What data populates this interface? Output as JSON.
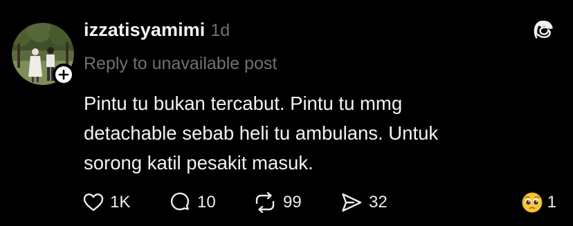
{
  "post": {
    "username": "izzatisyamimi",
    "timestamp": "1d",
    "reply_note": "Reply to unavailable post",
    "body_lines": [
      "Pintu tu bukan tercabut. Pintu tu mmg",
      "detachable sebab heli tu ambulans. Untuk",
      "sorong katil pesakit masuk."
    ]
  },
  "actions": {
    "likes": "1K",
    "replies": "10",
    "reposts": "99",
    "shares": "32"
  },
  "reaction": {
    "emoji_icon": "pleading-face-emoji",
    "count": "1"
  },
  "icons": {
    "threads_logo": "threads-logo-icon",
    "follow": "plus-icon",
    "like": "heart-icon",
    "reply": "speech-bubble-icon",
    "repost": "repost-arrows-icon",
    "share": "send-arrow-icon"
  },
  "colors": {
    "background": "#000000",
    "text_primary": "#f3f3f3",
    "text_secondary": "#717171"
  }
}
